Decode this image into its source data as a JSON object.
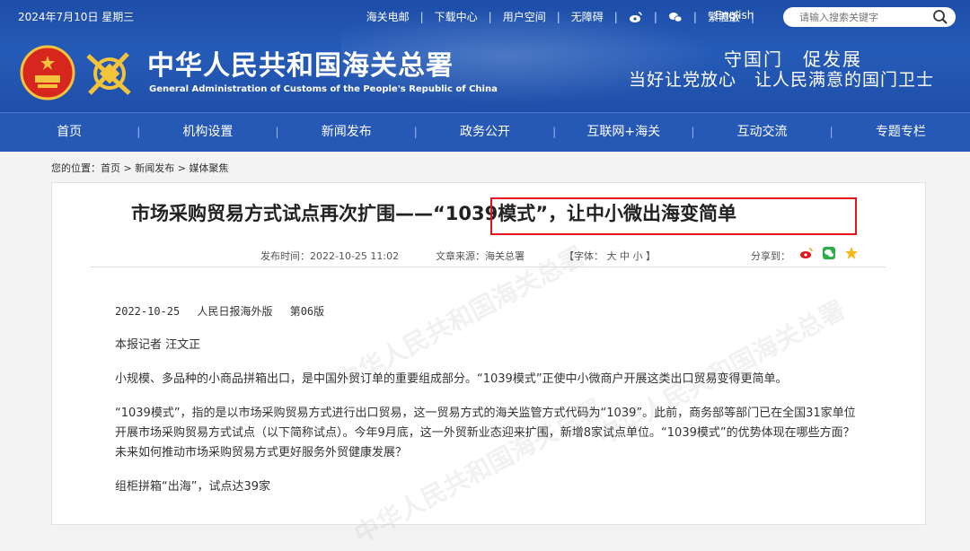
{
  "header": {
    "date": "2024年7月10日 星期三",
    "links": [
      "海关电邮",
      "下载中心",
      "用户空间",
      "无障碍"
    ],
    "traditional": "繁體版",
    "english": "English",
    "search_placeholder": "请输入搜索关键字",
    "title_cn": "中华人民共和国海关总署",
    "title_en": "General Administration of Customs of the People's Republic of China",
    "slogan_line1": "守国门　促发展",
    "slogan_line2": "当好让党放心　让人民满意的国门卫士"
  },
  "nav": [
    "首页",
    "机构设置",
    "新闻发布",
    "政务公开",
    "互联网+海关",
    "互动交流",
    "专题专栏"
  ],
  "breadcrumb": {
    "prefix": "您的位置：",
    "items": [
      "首页",
      "新闻发布",
      "媒体聚焦"
    ],
    "sep": " > "
  },
  "article": {
    "title": "市场采购贸易方式试点再次扩围——“1039模式”，让中小微出海变简单",
    "publish_time": "发布时间：2022-10-25 11:02",
    "source": "文章来源：海关总署",
    "font_size": "【字体： 大  中  小 】",
    "share": "分享到：",
    "paragraphs": [
      "2022-10-25　 人民日报海外版　 第06版",
      "本报记者 汪文正",
      "小规模、多品种的小商品拼箱出口，是中国外贸订单的重要组成部分。“1039模式”正使中小微商户开展这类出口贸易变得更简单。",
      "“1039模式”，指的是以市场采购贸易方式进行出口贸易，这一贸易方式的海关监管方式代码为“1039”。此前，商务部等部门已在全国31家单位开展市场采购贸易方式试点（以下简称试点）。今年9月底，这一外贸新业态迎来扩围，新增8家试点单位。“1039模式”的优势体现在哪些方面？未来如何推动市场采购贸易方式更好服务外贸健康发展？",
      "组柜拼箱“出海”，试点达39家"
    ],
    "watermark": "中华人民共和国海关总署"
  },
  "colors": {
    "header_blue": "#1f4fa9",
    "nav_blue": "#2559b5",
    "highlight_red": "#e3141b"
  }
}
